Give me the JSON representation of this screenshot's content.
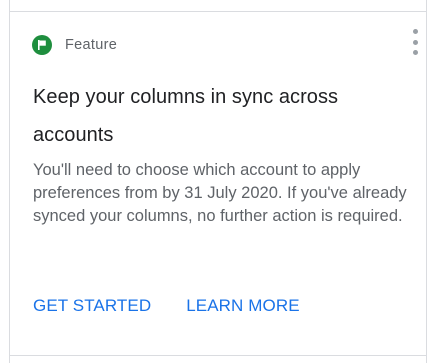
{
  "card": {
    "category": "Feature",
    "category_icon": "flag-icon",
    "menu_icon": "more-vertical-icon",
    "title": "Keep your columns in sync across accounts",
    "body": "You'll need to choose which account to apply preferences from by 31 July 2020. If you've already synced your columns, no further action is required.",
    "actions": {
      "get_started": "GET STARTED",
      "learn_more": "LEARN MORE"
    }
  },
  "colors": {
    "accent": "#1a73e8",
    "badge": "#1e8e3e",
    "title_text": "#202124",
    "secondary_text": "#5f6368",
    "border": "#dadce0"
  }
}
